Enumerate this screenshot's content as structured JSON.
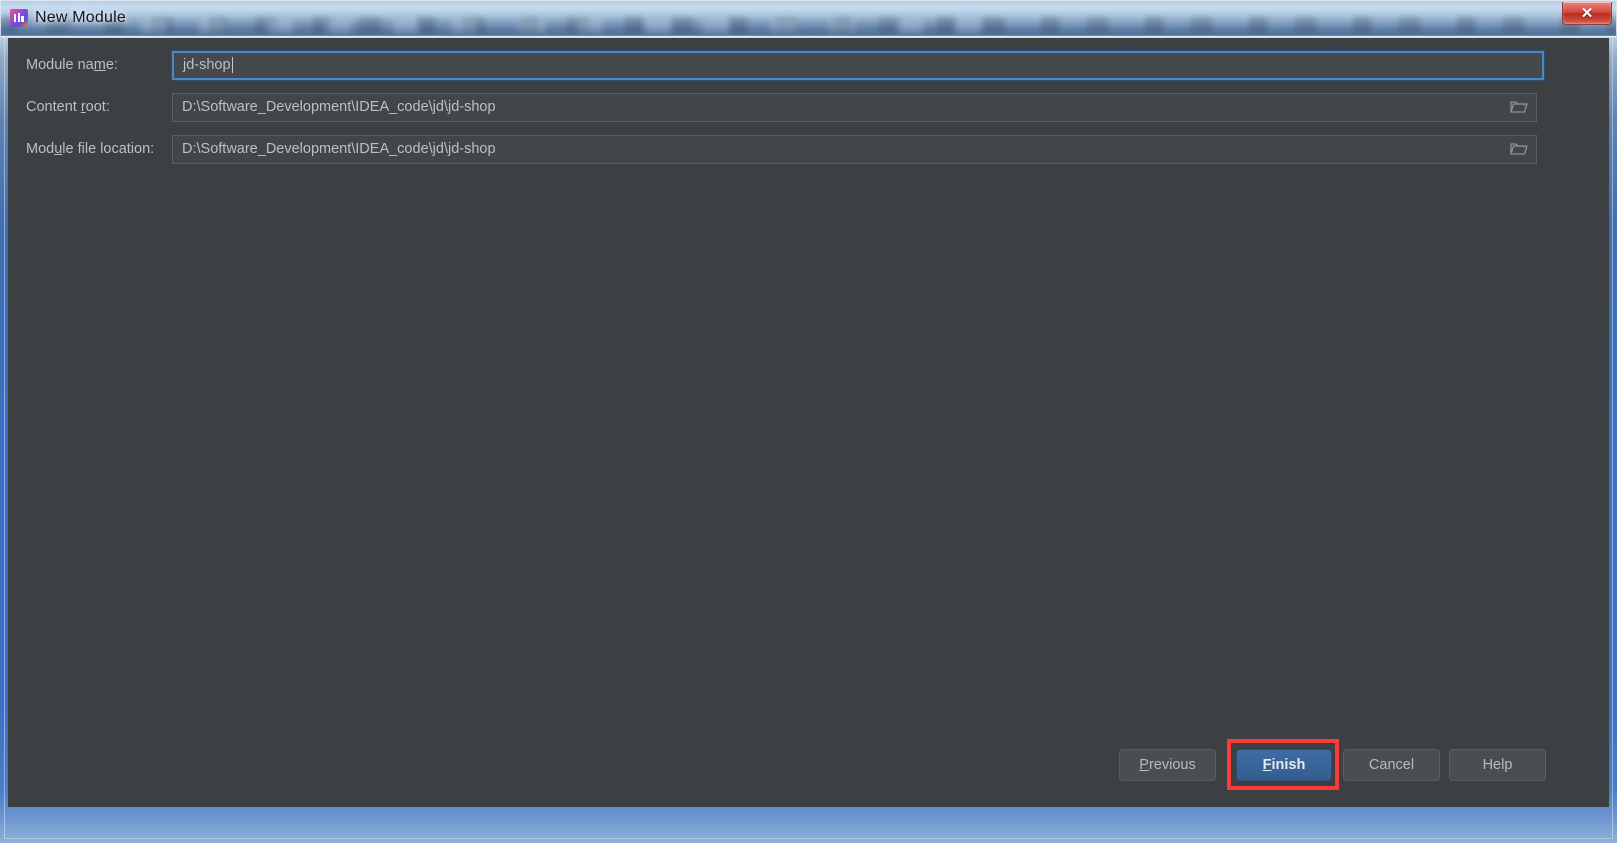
{
  "window": {
    "title": "New Module",
    "app_icon": "intellij-idea-icon",
    "close_label": "✕",
    "background_color": "#3c4043",
    "accent_color": "#4a88c7"
  },
  "form": {
    "fields": [
      {
        "id": "module-name",
        "label_prefix": "Module na",
        "label_mnemonic": "m",
        "label_suffix": "e:",
        "value": "jd-shop",
        "focused": true,
        "has_browse": false
      },
      {
        "id": "content-root",
        "label_prefix": "Content ",
        "label_mnemonic": "r",
        "label_suffix": "oot:",
        "value": "D:\\Software_Development\\IDEA_code\\jd\\jd-shop",
        "focused": false,
        "has_browse": true,
        "browse_icon": "folder-icon"
      },
      {
        "id": "module-file-location",
        "label_prefix": "Mod",
        "label_mnemonic": "u",
        "label_suffix": "le file location:",
        "value": "D:\\Software_Development\\IDEA_code\\jd\\jd-shop",
        "focused": false,
        "has_browse": true,
        "browse_icon": "folder-icon"
      }
    ]
  },
  "buttons": {
    "previous": {
      "prefix": "",
      "mnemonic": "P",
      "suffix": "revious"
    },
    "finish": {
      "prefix": "",
      "mnemonic": "F",
      "suffix": "inish"
    },
    "cancel": {
      "prefix": "Cancel",
      "mnemonic": "",
      "suffix": ""
    },
    "help": {
      "prefix": "Help",
      "mnemonic": "",
      "suffix": ""
    }
  },
  "annotation": {
    "target": "finish-button",
    "color": "#fb3b3b"
  }
}
